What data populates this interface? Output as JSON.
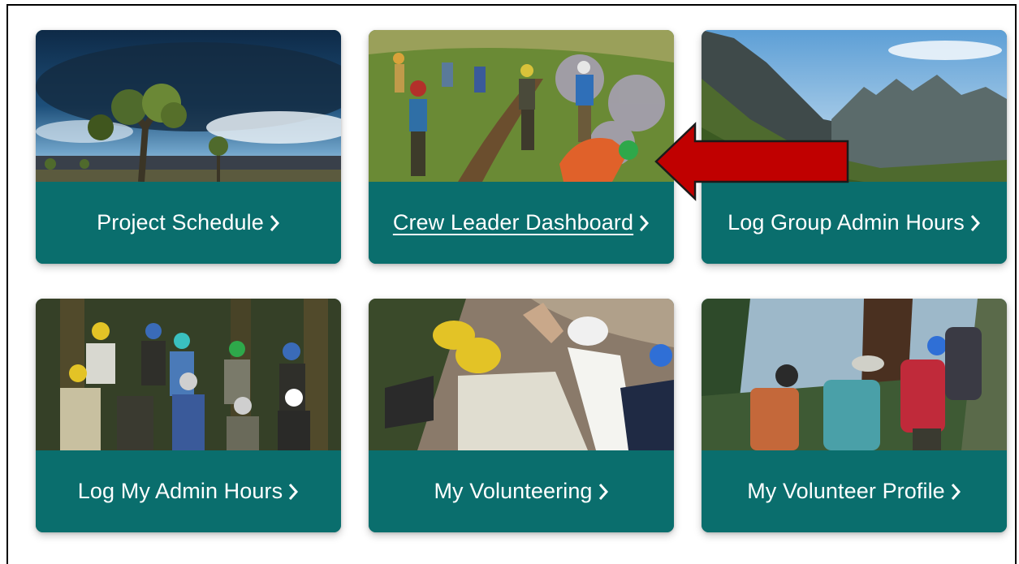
{
  "cards": [
    {
      "label": "Project Schedule",
      "chevron": "chevron-right-icon",
      "image": "desert-joshua-tree-storm"
    },
    {
      "label": "Crew Leader Dashboard",
      "chevron": "chevron-right-icon",
      "image": "trail-crew-meadow",
      "hovered": true
    },
    {
      "label": "Log Group Admin Hours",
      "chevron": "chevron-right-icon",
      "image": "mountain-ridge-valley"
    },
    {
      "label": "Log My Admin Hours",
      "chevron": "chevron-right-icon",
      "image": "volunteer-group-hardhats"
    },
    {
      "label": "My Volunteering",
      "chevron": "chevron-right-icon",
      "image": "volunteers-working-slope"
    },
    {
      "label": "My Volunteer Profile",
      "chevron": "chevron-right-icon",
      "image": "hikers-with-backpacks"
    }
  ],
  "colors": {
    "card_footer": "#0a6e6d",
    "annotation_arrow": "#c00000",
    "text": "#ffffff"
  },
  "annotation": {
    "type": "arrow",
    "pointing_to": "Crew Leader Dashboard"
  }
}
